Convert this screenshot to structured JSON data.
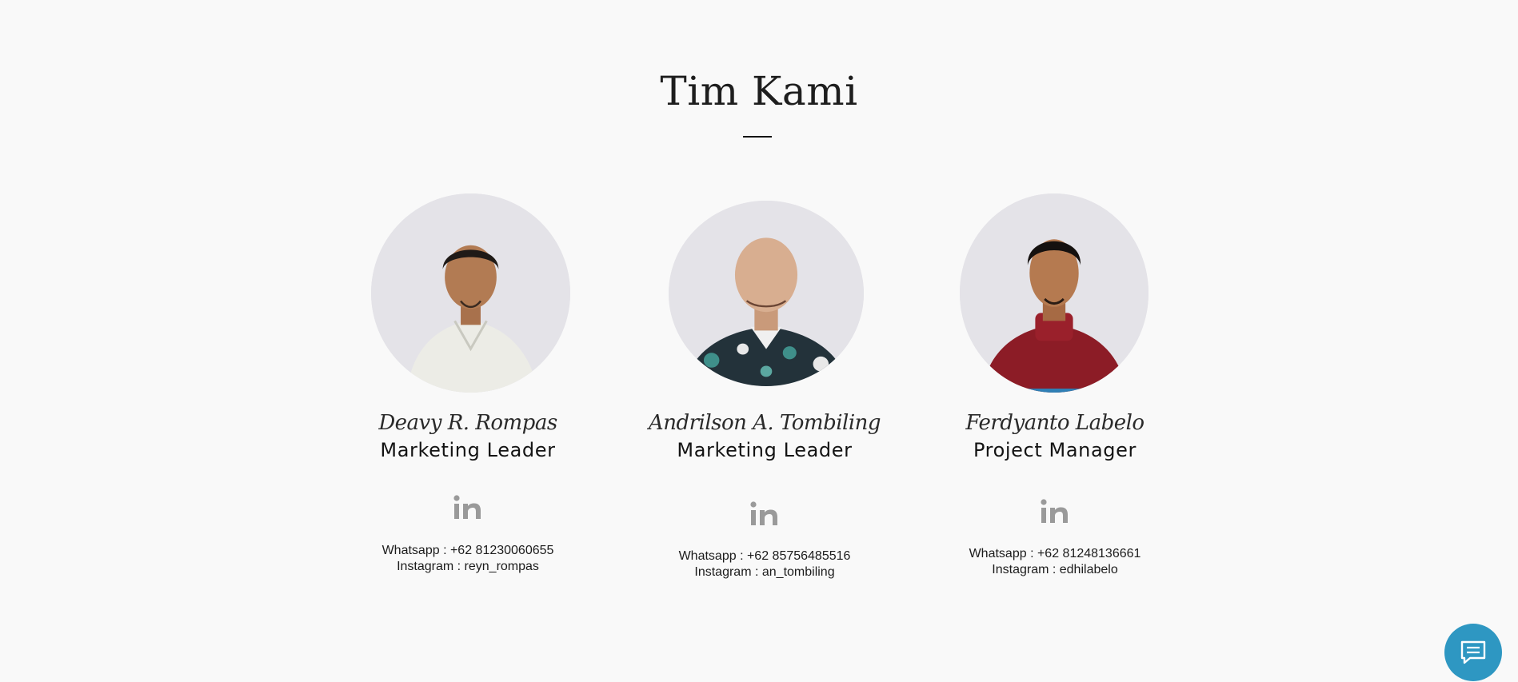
{
  "section": {
    "title": "Tim Kami"
  },
  "team": [
    {
      "name": "Deavy R. Rompas",
      "role": "Marketing Leader",
      "whatsapp": "Whatsapp : +62 81230060655",
      "instagram": "Instagram : reyn_rompas",
      "social_icon": "linkedin-icon"
    },
    {
      "name": "Andrilson A. Tombiling",
      "role": "Marketing Leader",
      "whatsapp": "Whatsapp : +62 85756485516",
      "instagram": "Instagram : an_tombiling",
      "social_icon": "linkedin-icon"
    },
    {
      "name": "Ferdyanto Labelo",
      "role": "Project Manager",
      "whatsapp": "Whatsapp : +62 81248136661",
      "instagram": "Instagram : edhilabelo",
      "social_icon": "linkedin-icon"
    }
  ],
  "chat_widget": {
    "icon": "chat-icon",
    "color": "#2e97c2"
  },
  "colors": {
    "background": "#f9f9f9",
    "icon_gray": "#9a9a9a"
  }
}
